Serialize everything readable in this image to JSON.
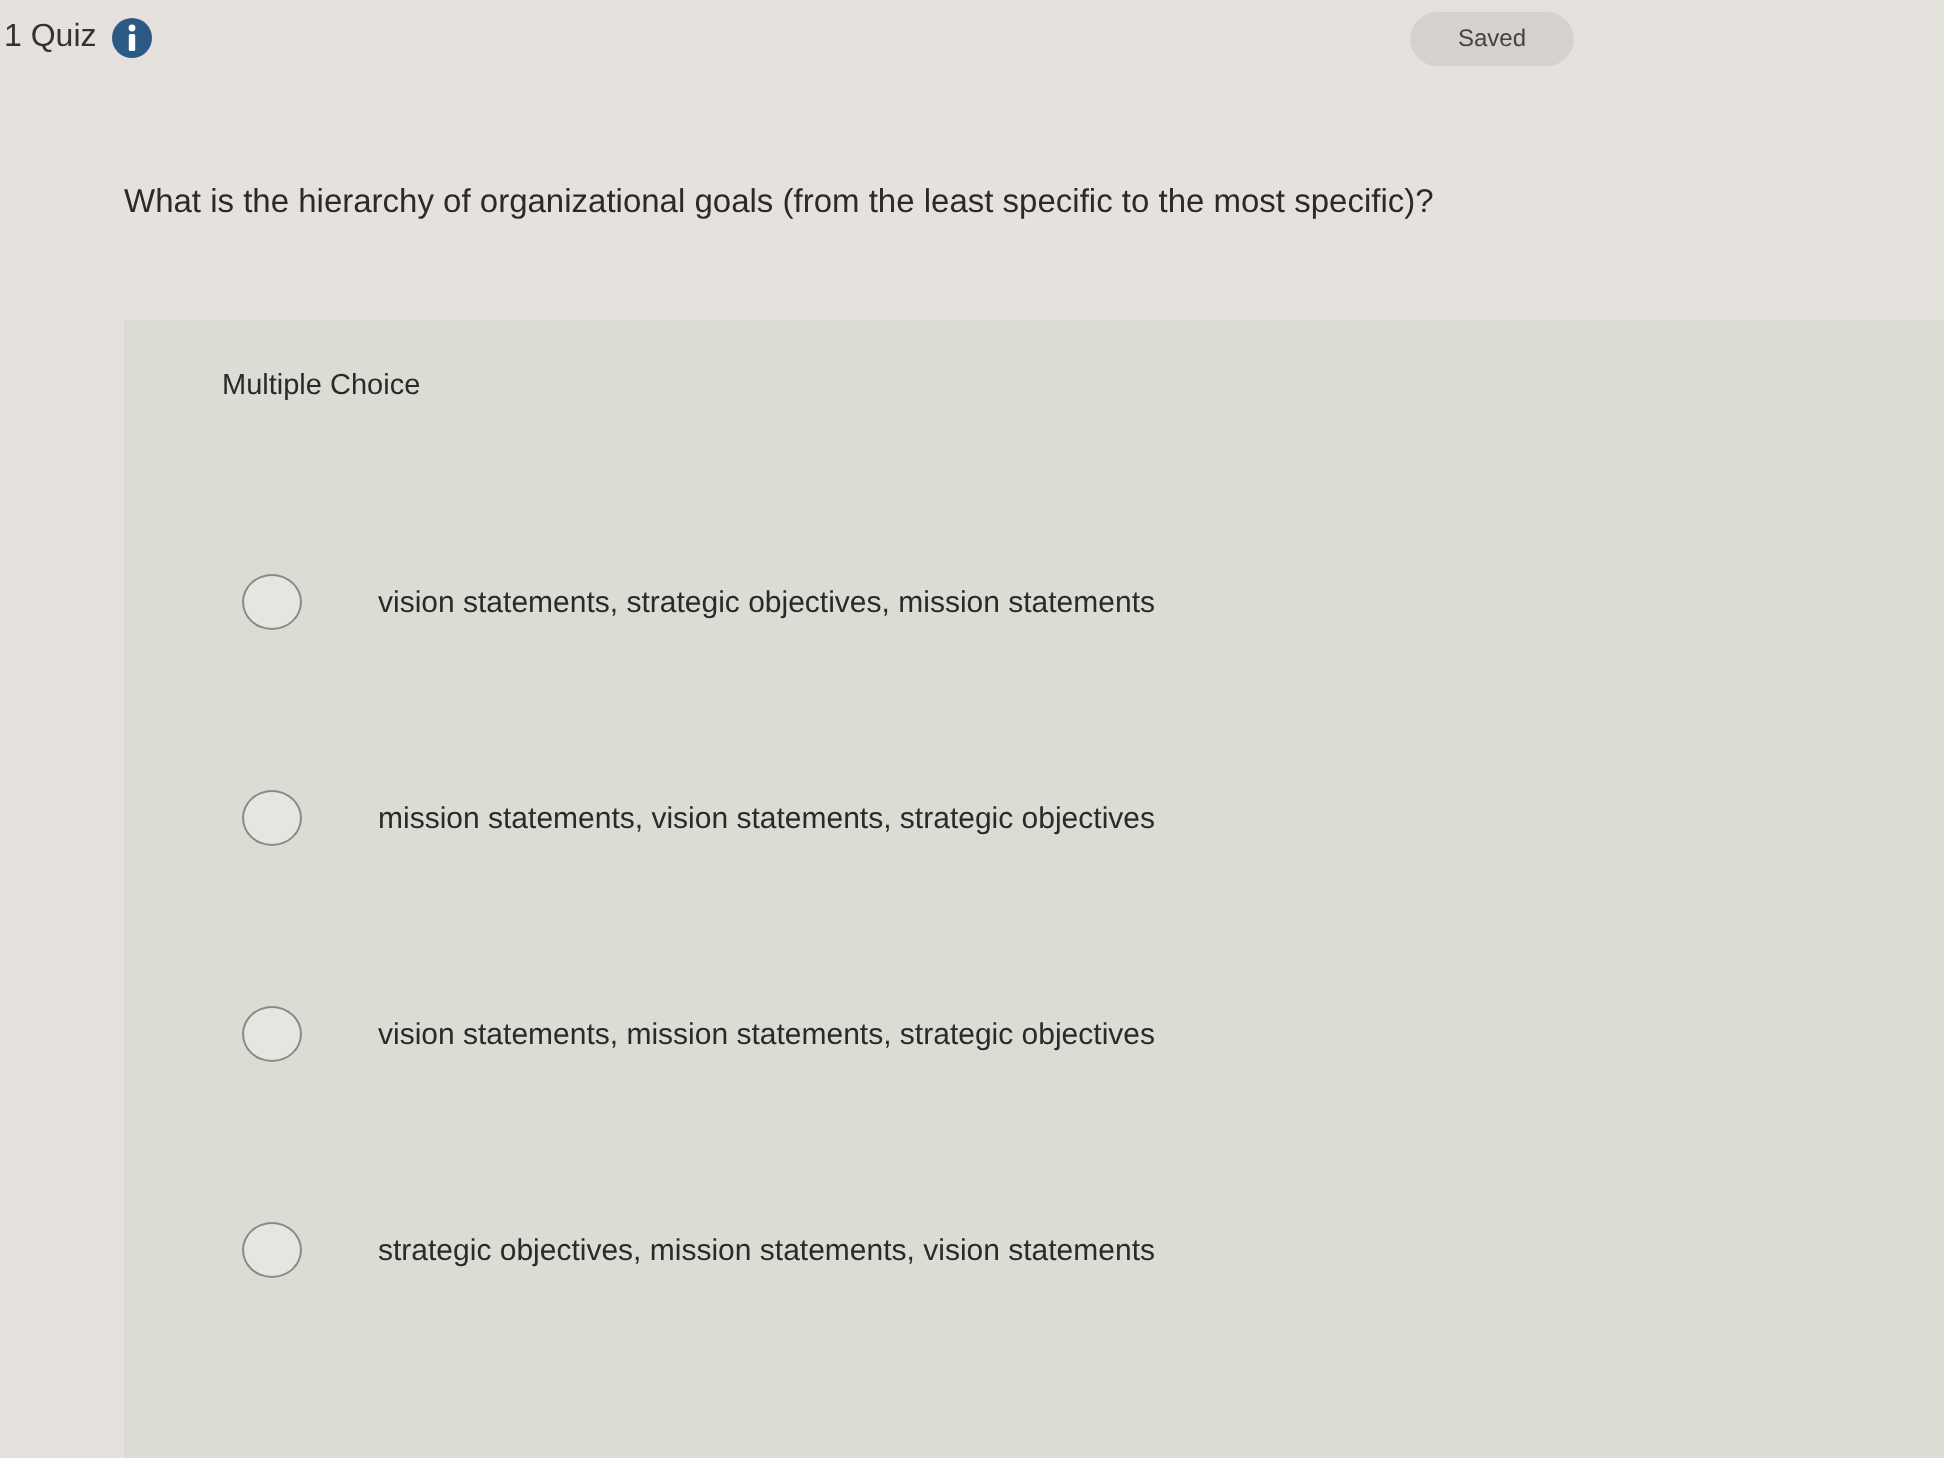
{
  "header": {
    "title": "1 Quiz",
    "status": "Saved"
  },
  "question": {
    "text": "What is the hierarchy of organizational goals (from the least specific to the most specific)?"
  },
  "answer_panel": {
    "type_label": "Multiple Choice",
    "options": [
      {
        "label": "vision statements, strategic objectives, mission statements",
        "selected": false
      },
      {
        "label": "mission statements, vision statements, strategic objectives",
        "selected": false
      },
      {
        "label": "vision statements, mission statements, strategic objectives",
        "selected": false
      },
      {
        "label": "strategic objectives, mission statements, vision statements",
        "selected": false
      }
    ]
  }
}
